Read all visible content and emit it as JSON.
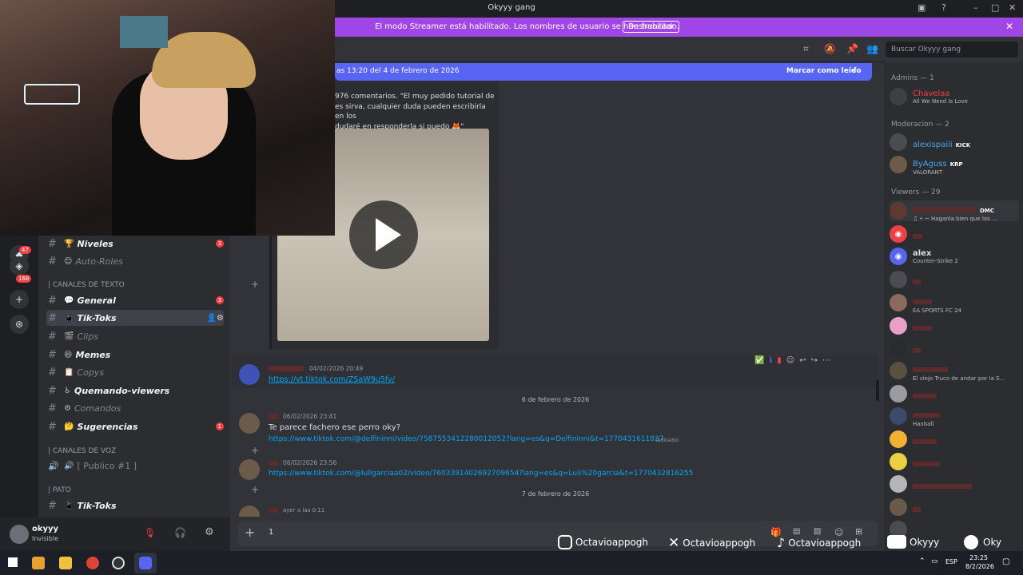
{
  "window": {
    "title": "Okyyy gang"
  },
  "streamer_banner": {
    "message": "El modo Streamer está habilitado. Los nombres de usuario se han truncado.",
    "button": "Deshabilitar"
  },
  "new_messages_bar": {
    "since": "as 13:20 del 4 de febrero de 2026",
    "mark_read": "Marcar como leído"
  },
  "search": {
    "placeholder": "Buscar Okyyy gang"
  },
  "guild_badges": {
    "badge1": "47",
    "badge2": "168"
  },
  "channels": {
    "items": [
      {
        "emoji": "🏆",
        "label": "Niveles",
        "badge": "3"
      },
      {
        "emoji": "😊",
        "label": "Auto-Roles"
      },
      {
        "emoji": "💬",
        "label": "General",
        "badge": "3"
      },
      {
        "emoji": "📱",
        "label": "Tik-Toks",
        "selected": true
      },
      {
        "emoji": "🎬",
        "label": "Clips"
      },
      {
        "emoji": "😆",
        "label": "Memes"
      },
      {
        "emoji": "📋",
        "label": "Copys"
      },
      {
        "emoji": "♿",
        "label": "Quemando-viewers"
      },
      {
        "emoji": "⚙",
        "label": "Comandos"
      },
      {
        "emoji": "🤔",
        "label": "Sugerencias",
        "badge": "1"
      },
      {
        "emoji": "🔊",
        "label": "[ Publico #1 ]"
      },
      {
        "emoji": "📱",
        "label": "Tik-Toks"
      }
    ],
    "category_text": "| CANALES DE TEXTO",
    "category_voice": "| CANALES DE VOZ",
    "category_pato": "| PATO"
  },
  "user": {
    "name": "okyyy",
    "status": "Invisible"
  },
  "messages": {
    "m0_comments": "976 comentarios. \"El muy pedido tutorial de",
    "m0_line2": "es sirva, cualquier duda pueden escribirla en los",
    "m0_line3": "dudaré en responderla si puedo 🦊\"",
    "m1_time": "04/02/2026 20:49",
    "m1_link": "https://vt.tiktok.com/ZSaW9u5fv/",
    "day1": "6 de febrero de 2026",
    "m2_time": "06/02/2026 23:41",
    "m2_text": "Te parece fachero ese perro oky?",
    "m2_link": "https://www.tiktok.com/@delfininni/video/7587553412280012052?lang=es&q=Delfininni&t=1770431611837",
    "m2_edited": "(editado)",
    "m3_time": "06/02/2026 23:56",
    "m3_link": "https://www.tiktok.com/@luligarciaa02/video/7603391402692709654?lang=es&q=Luli%20garcia&t=1770432816255",
    "day2": "7 de febrero de 2026",
    "m4_time": "ayer a las 0:11",
    "composer_text": "1"
  },
  "members": {
    "admins_header": "Admins — 1",
    "mods_header": "Moderacion — 2",
    "viewers_header": "Viewers — 29",
    "admin": {
      "name": "Chavelaa",
      "activity": "All We Need Is Love"
    },
    "mod1": {
      "name": "alexispaiii",
      "tag": "KICK"
    },
    "mod2": {
      "name": "ByAguss",
      "tag": "KRP",
      "activity": "VALORANT"
    },
    "v_tag": "DMC",
    "v1_activity": "♫ • ~ Haganla bien que los ...",
    "v_alex": {
      "name": "alex",
      "activity": "Counter-Strike 2"
    },
    "v_fc": "EA SPORTS FC 24",
    "v_truco": "El viejo Truco de andar por la S...",
    "v_hax": "Haxball"
  },
  "social": {
    "instagram": "Octavioappogh",
    "x": "Octavioappogh",
    "tiktok": "Octavioappogh",
    "youtube": "Okyyy",
    "spotify": "Oky"
  },
  "taskbar": {
    "lang": "ESP",
    "time": "23:25",
    "date": "8/2/2026"
  },
  "colors": {
    "accent": "#5865f2",
    "banner": "#a045e6",
    "link": "#00a8fc"
  }
}
